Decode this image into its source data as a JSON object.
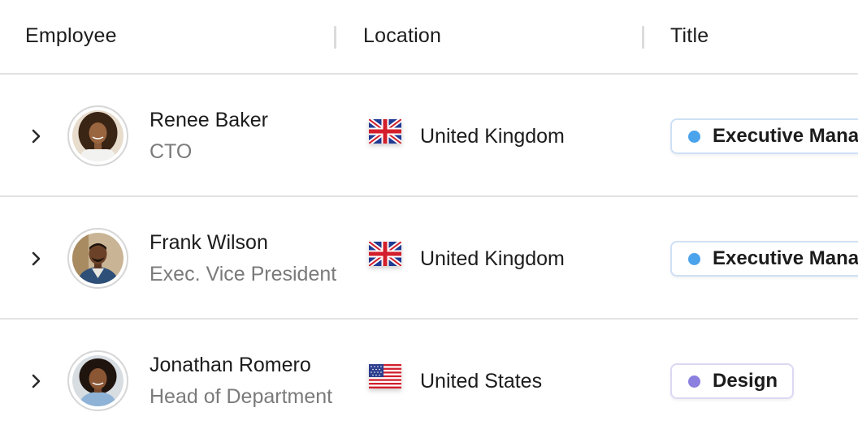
{
  "table": {
    "columns": [
      {
        "label": "Employee"
      },
      {
        "label": "Location"
      },
      {
        "label": "Title"
      }
    ],
    "rows": [
      {
        "name": "Renee Baker",
        "role": "CTO",
        "country": "United Kingdom",
        "flag_icon": "uk-flag-icon",
        "title": "Executive Management",
        "title_color": "#4ba3ec"
      },
      {
        "name": "Frank Wilson",
        "role": "Exec. Vice President",
        "country": "United Kingdom",
        "flag_icon": "uk-flag-icon",
        "title": "Executive Management",
        "title_color": "#4ba3ec"
      },
      {
        "name": "Jonathan Romero",
        "role": "Head of Department",
        "country": "United States",
        "flag_icon": "us-flag-icon",
        "title": "Design",
        "title_color": "#8b7fe0"
      }
    ]
  }
}
